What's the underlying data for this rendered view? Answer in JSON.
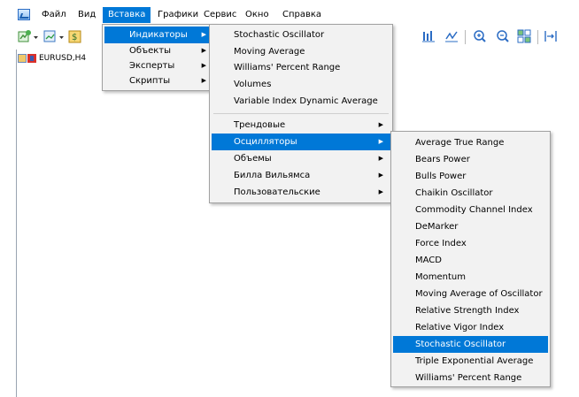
{
  "menubar": {
    "items": [
      {
        "label": "Файл"
      },
      {
        "label": "Вид"
      },
      {
        "label": "Вставка"
      },
      {
        "label": "Графики"
      },
      {
        "label": "Сервис"
      },
      {
        "label": "Окно"
      },
      {
        "label": "Справка"
      }
    ],
    "active_index": 2
  },
  "tree": {
    "window_label": "EURUSD,H4"
  },
  "insert_menu": {
    "items": [
      {
        "label": "Индикаторы",
        "submenu": true,
        "highlighted": true
      },
      {
        "label": "Объекты",
        "submenu": true
      },
      {
        "label": "Эксперты",
        "submenu": true
      },
      {
        "label": "Скрипты",
        "submenu": true
      }
    ]
  },
  "indicators_menu": {
    "top_items": [
      {
        "label": "Stochastic Oscillator"
      },
      {
        "label": "Moving Average"
      },
      {
        "label": "Williams' Percent Range"
      },
      {
        "label": "Volumes"
      },
      {
        "label": "Variable Index Dynamic Average"
      }
    ],
    "groups": [
      {
        "label": "Трендовые",
        "submenu": true
      },
      {
        "label": "Осцилляторы",
        "submenu": true,
        "highlighted": true
      },
      {
        "label": "Объемы",
        "submenu": true
      },
      {
        "label": "Билла Вильямса",
        "submenu": true
      },
      {
        "label": "Пользовательские",
        "submenu": true
      }
    ]
  },
  "oscillators_menu": {
    "items": [
      {
        "label": "Average True Range"
      },
      {
        "label": "Bears Power"
      },
      {
        "label": "Bulls Power"
      },
      {
        "label": "Chaikin Oscillator"
      },
      {
        "label": "Commodity Channel Index"
      },
      {
        "label": "DeMarker"
      },
      {
        "label": "Force Index"
      },
      {
        "label": "MACD"
      },
      {
        "label": "Momentum"
      },
      {
        "label": "Moving Average of Oscillator"
      },
      {
        "label": "Relative Strength Index"
      },
      {
        "label": "Relative Vigor Index"
      },
      {
        "label": "Stochastic Oscillator",
        "highlighted": true
      },
      {
        "label": "Triple Exponential Average"
      },
      {
        "label": "Williams' Percent Range"
      }
    ]
  },
  "colors": {
    "highlight": "#0078d7",
    "menu_bg": "#f2f2f2"
  }
}
